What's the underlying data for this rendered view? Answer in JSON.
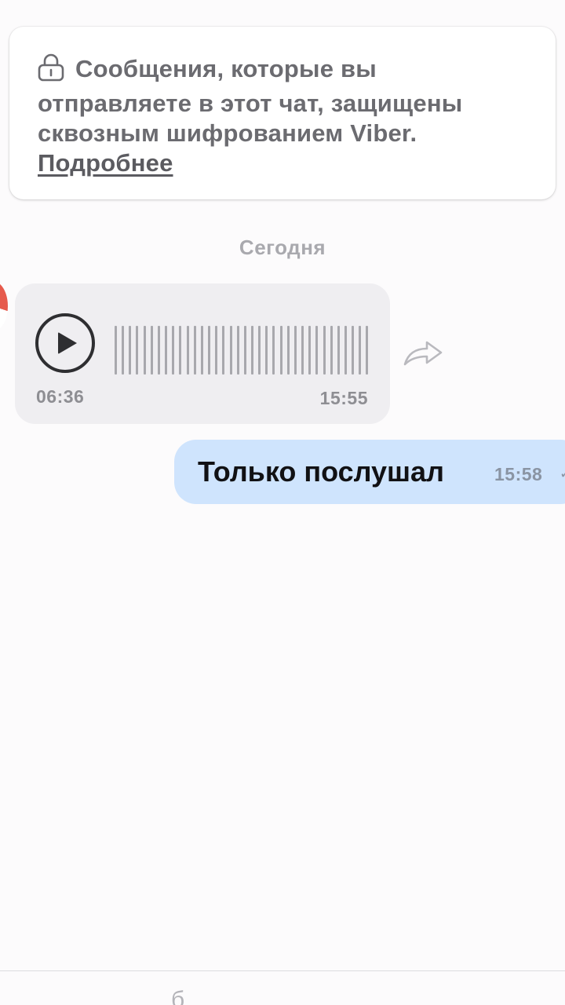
{
  "encryption_notice": {
    "text": "Сообщения, которые вы отправляете в этот чат, защищены сквозным шифрованием Viber.",
    "link_label": "Подробнее",
    "icon": "lock-icon"
  },
  "date_separator": "Сегодня",
  "messages": [
    {
      "type": "voice",
      "direction": "incoming",
      "duration": "06:36",
      "time": "15:55",
      "icons": [
        "play-icon",
        "forward-icon"
      ]
    },
    {
      "type": "text",
      "direction": "outgoing",
      "text": "Только послушал",
      "time": "15:58",
      "status_icon": "check-icon"
    }
  ],
  "composer": {
    "partial_placeholder": "б"
  },
  "colors": {
    "outgoing_bubble": "#cfe4fd",
    "incoming_bubble": "#efeef1",
    "background": "#fcfbfc",
    "secondary_text": "#8e8e93"
  }
}
